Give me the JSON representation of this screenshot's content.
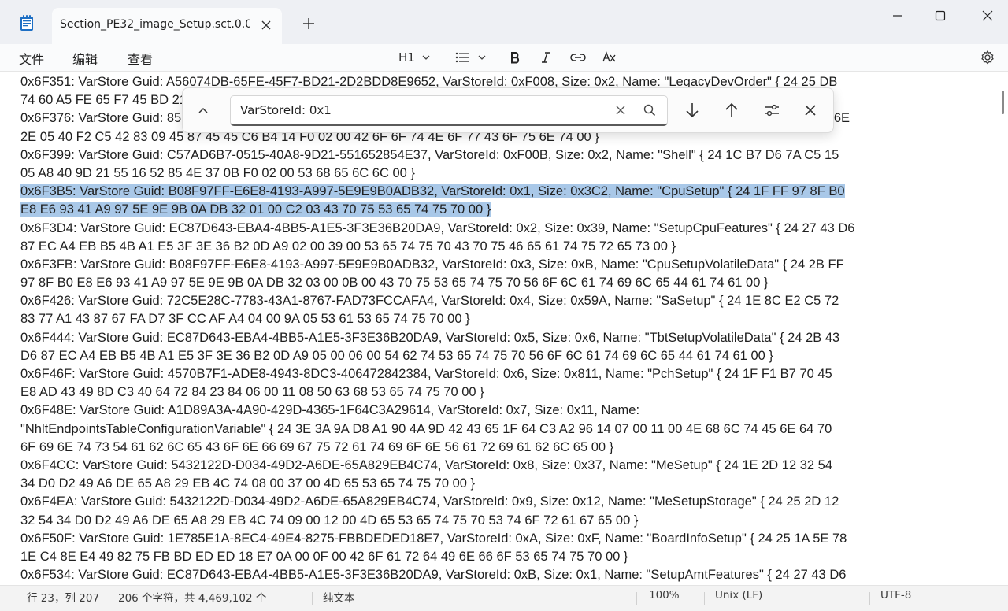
{
  "tab": {
    "title": "Section_PE32_image_Setup.sct.0.0.e"
  },
  "menu": {
    "file": "文件",
    "edit": "编辑",
    "view": "查看"
  },
  "toolbar": {
    "heading": "H1"
  },
  "find": {
    "query": "VarStoreId: 0x1"
  },
  "editor": {
    "lines": [
      {
        "text": "0x6F351:   VarStore Guid: A56074DB-65FE-45F7-BD21-2D2BDD8E9652, VarStoreId: 0xF008, Size: 0x2, Name: \"LegacyDevOrder\" { 24 25 DB",
        "highlight": false
      },
      {
        "text": "74 60 A5 FE 65 F7 45 BD 21 2D 2B DD 8E 96 52 08 F0 02 00 4C 65 67 61 63 79 44 65 76 4F 72 64 65 72 00 }",
        "highlight": false
      },
      {
        "text": "0x6F376:   VarStore Guid: 85E7C2E0-F2C5-4283-0945-8745C6B414F0, VarStoreId: 0xF00A, Size: 0x2, Name: \"BootOptionCount\" { 24 23 B0 6E",
        "highlight": false
      },
      {
        "text": "2E 05 40 F2 C5 42 83 09 45 87 45 45 C6 B4 14 F0 02 00 42 6F 6F 74 4E 6F 77 43 6F 75 6E 74 00 }",
        "highlight": false
      },
      {
        "text": "0x6F399:   VarStore Guid: C57AD6B7-0515-40A8-9D21-551652854E37, VarStoreId: 0xF00B, Size: 0x2, Name: \"Shell\" { 24 1C B7 D6 7A C5 15",
        "highlight": false
      },
      {
        "text": "05 A8 40 9D 21 55 16 52 85 4E 37 0B F0 02 00 53 68 65 6C 6C 00 }",
        "highlight": false
      },
      {
        "text": "0x6F3B5:   VarStore Guid: B08F97FF-E6E8-4193-A997-5E9E9B0ADB32, VarStoreId: 0x1, Size: 0x3C2, Name: \"CpuSetup\" { 24 1F FF 97 8F B0",
        "highlight": true
      },
      {
        "text": "E8 E6 93 41 A9 97 5E 9E 9B 0A DB 32 01 00 C2 03 43 70 75 53 65 74 75 70 00 }",
        "highlight": true
      },
      {
        "text": "0x6F3D4:   VarStore Guid: EC87D643-EBA4-4BB5-A1E5-3F3E36B20DA9, VarStoreId: 0x2, Size: 0x39, Name: \"SetupCpuFeatures\" { 24 27 43 D6",
        "highlight": false
      },
      {
        "text": "87 EC A4 EB B5 4B A1 E5 3F 3E 36 B2 0D A9 02 00 39 00 53 65 74 75 70 43 70 75 46 65 61 74 75 72 65 73 00 }",
        "highlight": false
      },
      {
        "text": "0x6F3FB:   VarStore Guid: B08F97FF-E6E8-4193-A997-5E9E9B0ADB32, VarStoreId: 0x3, Size: 0xB, Name: \"CpuSetupVolatileData\" { 24 2B FF",
        "highlight": false
      },
      {
        "text": "97 8F B0 E8 E6 93 41 A9 97 5E 9E 9B 0A DB 32 03 00 0B 00 43 70 75 53 65 74 75 70 56 6F 6C 61 74 69 6C 65 44 61 74 61 00 }",
        "highlight": false
      },
      {
        "text": "0x6F426:   VarStore Guid: 72C5E28C-7783-43A1-8767-FAD73FCCAFA4, VarStoreId: 0x4, Size: 0x59A, Name: \"SaSetup\" { 24 1E 8C E2 C5 72",
        "highlight": false
      },
      {
        "text": "83 77 A1 43 87 67 FA D7 3F CC AF A4 04 00 9A 05 53 61 53 65 74 75 70 00 }",
        "highlight": false
      },
      {
        "text": "0x6F444:   VarStore Guid: EC87D643-EBA4-4BB5-A1E5-3F3E36B20DA9, VarStoreId: 0x5, Size: 0x6, Name: \"TbtSetupVolatileData\" { 24 2B 43",
        "highlight": false
      },
      {
        "text": "D6 87 EC A4 EB B5 4B A1 E5 3F 3E 36 B2 0D A9 05 00 06 00 54 62 74 53 65 74 75 70 56 6F 6C 61 74 69 6C 65 44 61 74 61 00 }",
        "highlight": false
      },
      {
        "text": "0x6F46F:   VarStore Guid: 4570B7F1-ADE8-4943-8DC3-406472842384, VarStoreId: 0x6, Size: 0x811, Name: \"PchSetup\" { 24 1F F1 B7 70 45",
        "highlight": false
      },
      {
        "text": "E8 AD 43 49 8D C3 40 64 72 84 23 84 06 00 11 08 50 63 68 53 65 74 75 70 00 }",
        "highlight": false
      },
      {
        "text": "0x6F48E:   VarStore Guid: A1D89A3A-4A90-429D-4365-1F64C3A29614, VarStoreId: 0x7, Size: 0x11, Name:",
        "highlight": false
      },
      {
        "text": "\"NhltEndpointsTableConfigurationVariable\" { 24 3E 3A 9A D8 A1 90 4A 9D 42 43 65 1F 64 C3 A2 96 14 07 00 11 00 4E 68 6C 74 45 6E 64 70",
        "highlight": false
      },
      {
        "text": "6F 69 6E 74 73 54 61 62 6C 65 43 6F 6E 66 69 67 75 72 61 74 69 6F 6E 56 61 72 69 61 62 6C 65 00 }",
        "highlight": false
      },
      {
        "text": "0x6F4CC:   VarStore Guid: 5432122D-D034-49D2-A6DE-65A829EB4C74, VarStoreId: 0x8, Size: 0x37, Name: \"MeSetup\" { 24 1E 2D 12 32 54",
        "highlight": false
      },
      {
        "text": "34 D0 D2 49 A6 DE 65 A8 29 EB 4C 74 08 00 37 00 4D 65 53 65 74 75 70 00 }",
        "highlight": false
      },
      {
        "text": "0x6F4EA:   VarStore Guid: 5432122D-D034-49D2-A6DE-65A829EB4C74, VarStoreId: 0x9, Size: 0x12, Name: \"MeSetupStorage\" { 24 25 2D 12",
        "highlight": false
      },
      {
        "text": "32 54 34 D0 D2 49 A6 DE 65 A8 29 EB 4C 74 09 00 12 00 4D 65 53 65 74 75 70 53 74 6F 72 61 67 65 00 }",
        "highlight": false
      },
      {
        "text": "0x6F50F:   VarStore Guid: 1E785E1A-8EC4-49E4-8275-FBBDEDED18E7, VarStoreId: 0xA, Size: 0xF, Name: \"BoardInfoSetup\" { 24 25 1A 5E 78",
        "highlight": false
      },
      {
        "text": "1E C4 8E E4 49 82 75 FB BD ED ED 18 E7 0A 00 0F 00 42 6F 61 72 64 49 6E 66 6F 53 65 74 75 70 00 }",
        "highlight": false
      },
      {
        "text": "0x6F534:   VarStore Guid: EC87D643-EBA4-4BB5-A1E5-3F3E36B20DA9, VarStoreId: 0xB, Size: 0x1, Name: \"SetupAmtFeatures\" { 24 27 43 D6",
        "highlight": false
      }
    ]
  },
  "status": {
    "position": "行 23，列 207",
    "chars": "206 个字符，共 4,469,102 个",
    "format": "纯文本",
    "zoom": "100%",
    "eol": "Unix (LF)",
    "encoding": "UTF-8"
  },
  "colors": {
    "selection": "#a9c8e8",
    "titlebar": "#eef0f4",
    "accent_icon": "#1e6fc4"
  }
}
